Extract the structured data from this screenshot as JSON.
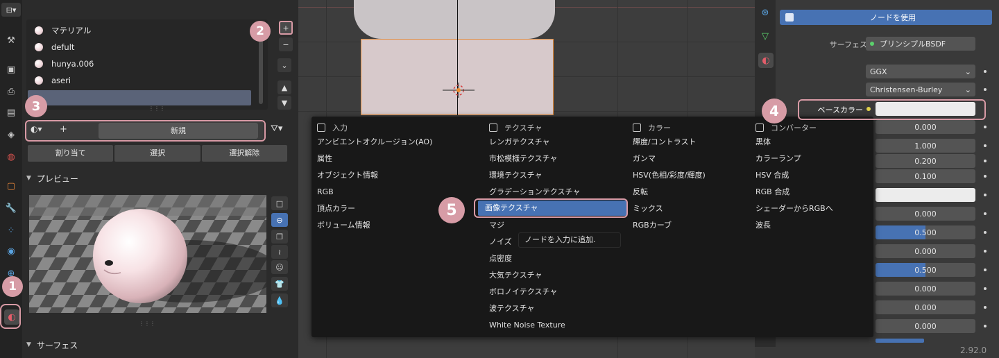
{
  "colors": {
    "accent": "#4772b3",
    "annotation": "#d79ca6",
    "panel_bg": "#2b2b2b"
  },
  "left_panel": {
    "editor_type_icon": "node-editor-icon",
    "tabs": [
      "tool-icon",
      "render-icon",
      "output-icon",
      "view-layer-icon",
      "scene-icon",
      "world-icon",
      "object-icon",
      "modifier-icon",
      "particles-icon",
      "physics-icon",
      "constraints-icon",
      "material-icon"
    ],
    "material_slots": [
      "マテリアル",
      "defult",
      "hunya.006",
      "aseri",
      ""
    ],
    "material_selector": {
      "add_label": "+",
      "new_label": "新規"
    },
    "assign_buttons": [
      "割り当て",
      "選択",
      "選択解除"
    ],
    "preview_section": "プレビュー",
    "surface_section": "サーフェス",
    "preview_shapes": [
      "flat-icon",
      "sphere-icon",
      "cube-icon",
      "hair-icon",
      "monkey-icon",
      "cloth-icon",
      "fluid-icon"
    ]
  },
  "node_panel": {
    "use_nodes_label": "ノードを使用",
    "surface_label": "サーフェス",
    "surface_value": "プリンシプルBSDF",
    "distribution": "GGX",
    "subsurface_method": "Christensen-Burley",
    "base_color_label": "ベースカラー",
    "values": [
      "0.000",
      "1.000",
      "0.200",
      "0.100",
      "0.000",
      "0.500",
      "0.000",
      "0.500",
      "0.000",
      "0.000",
      "0.000"
    ]
  },
  "add_menu": {
    "columns": [
      {
        "title": "入力",
        "items": [
          "アンビエントオクルージョン(AO)",
          "属性",
          "オブジェクト情報",
          "RGB",
          "頂点カラー",
          "ボリューム情報"
        ]
      },
      {
        "title": "テクスチャ",
        "items": [
          "レンガテクスチャ",
          "市松模様テクスチャ",
          "環境テクスチャ",
          "グラデーションテクスチャ",
          "画像テクスチャ",
          "マジ",
          "ノイズ",
          "点密度",
          "大気テクスチャ",
          "ボロノイテクスチャ",
          "波テクスチャ",
          "White Noise Texture"
        ]
      },
      {
        "title": "カラー",
        "items": [
          "輝度/コントラスト",
          "ガンマ",
          "HSV(色相/彩度/輝度)",
          "反転",
          "ミックス",
          "RGBカーブ"
        ]
      },
      {
        "title": "コンバーター",
        "items": [
          "黒体",
          "カラーランプ",
          "HSV 合成",
          "RGB 合成",
          "シェーダーからRGBへ",
          "波長"
        ]
      }
    ],
    "tooltip": "ノードを入力に追加."
  },
  "annotations": [
    "1",
    "2",
    "3",
    "4",
    "5"
  ],
  "version": "2.92.0"
}
